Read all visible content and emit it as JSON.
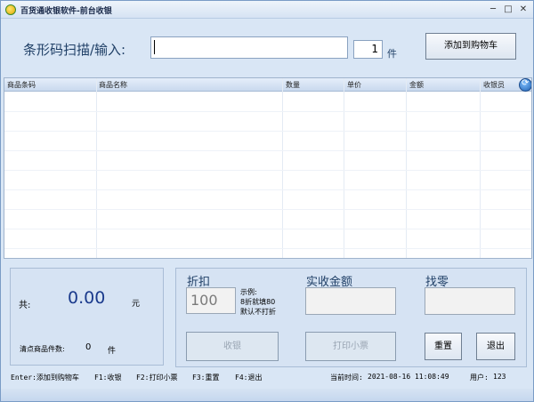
{
  "window": {
    "title": "百货通收银软件-前台收银",
    "minimize": "─",
    "maximize": "□",
    "close": "✕"
  },
  "barcode": {
    "label": "条形码扫描/输入:",
    "value": "",
    "quantity": "1",
    "quantity_unit": "件",
    "add_button": "添加到购物车"
  },
  "grid": {
    "columns": [
      "商品条码",
      "商品名称",
      "数量",
      "单价",
      "金额",
      "收银员"
    ],
    "rows": []
  },
  "summary": {
    "total_label": "共:",
    "total_value": "0.00",
    "total_unit": "元",
    "count_label": "清点商品件数:",
    "count_value": "0",
    "count_unit": "件"
  },
  "payment": {
    "discount_title": "折扣",
    "discount_value": "100",
    "hint_line1": "示例:",
    "hint_line2": "8折就填80",
    "hint_line3": "默认不打折",
    "received_title": "实收金额",
    "change_title": "找零",
    "checkout_button": "收银",
    "print_button": "打印小票",
    "reset_button": "重置",
    "exit_button": "退出"
  },
  "status": {
    "enter_hint": "Enter:添加到购物车",
    "f1_hint": "F1:收银",
    "f2_hint": "F2:打印小票",
    "f3_hint": "F3:重置",
    "f4_hint": "F4:退出",
    "time_label": "当前时间:",
    "time_value": "2021-08-16 11:08:49",
    "user_label": "用户:",
    "user_value": "123"
  },
  "colors": {
    "window_bg": "#d9e6f5",
    "accent_text": "#1f3f66",
    "total_value": "#1a3a8c"
  }
}
